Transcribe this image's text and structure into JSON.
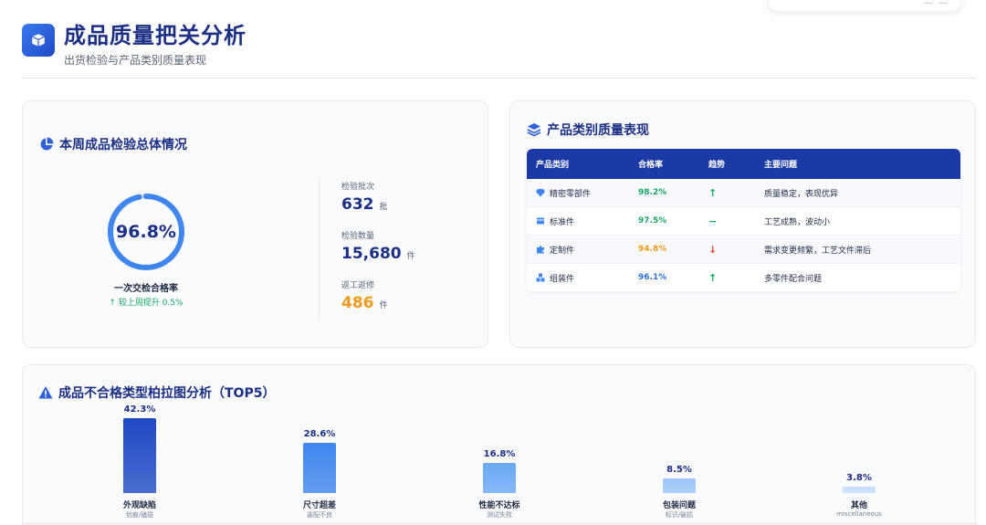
{
  "header": {
    "title": "成品质量把关分析",
    "subtitle": "出货检验与产品类别质量表现"
  },
  "overview": {
    "title": "本周成品检验总体情况",
    "pass_rate": "96.8%",
    "pass_rate_value": 96.8,
    "pass_rate_label": "一次交检合格率",
    "pass_rate_change": "较上周提升 0.5%",
    "stats": [
      {
        "label": "检验批次",
        "value": "632",
        "unit": "批"
      },
      {
        "label": "检验数量",
        "value": "15,680",
        "unit": "件"
      },
      {
        "label": "返工返修",
        "value": "486",
        "unit": "件"
      }
    ]
  },
  "category": {
    "title": "产品类别质量表现",
    "columns": [
      "产品类别",
      "合格率",
      "趋势",
      "主要问题"
    ],
    "rows": [
      {
        "name": "精密零部件",
        "icon": "gem-icon",
        "rate": "98.2%",
        "rate_color": "green",
        "trend": "↑",
        "trend_color": "green",
        "issue": "质量稳定，表现优异"
      },
      {
        "name": "标准件",
        "icon": "box-icon",
        "rate": "97.5%",
        "rate_color": "green",
        "trend": "−",
        "trend_color": "green",
        "issue": "工艺成熟，波动小"
      },
      {
        "name": "定制件",
        "icon": "puzzle-icon",
        "rate": "94.8%",
        "rate_color": "orange",
        "trend": "↓",
        "trend_color": "red",
        "issue": "需求变更频繁，工艺文件滞后"
      },
      {
        "name": "组装件",
        "icon": "cubes-icon",
        "rate": "96.1%",
        "rate_color": "blue",
        "trend": "↑",
        "trend_color": "green",
        "issue": "多零件配合问题"
      }
    ]
  },
  "pareto": {
    "title": "成品不合格类型柏拉图分析（TOP5）"
  },
  "chart_data": {
    "type": "bar",
    "categories": [
      "外观缺陷",
      "尺寸超差",
      "性能不达标",
      "包装问题",
      "其他"
    ],
    "subcategories": [
      "划痕/磕碰",
      "装配不良",
      "测试失败",
      "标识/破损",
      "miscellaneous"
    ],
    "values": [
      42.3,
      28.6,
      16.8,
      8.5,
      3.8
    ],
    "value_labels": [
      "42.3%",
      "28.6%",
      "16.8%",
      "8.5%",
      "3.8%"
    ],
    "colors": [
      "#1f49c4",
      "#3f86ef",
      "#6aa8f5",
      "#9cc6fa",
      "#c5defd"
    ],
    "title": "成品不合格类型柏拉图分析（TOP5）",
    "ylim": [
      0,
      42.3
    ]
  }
}
